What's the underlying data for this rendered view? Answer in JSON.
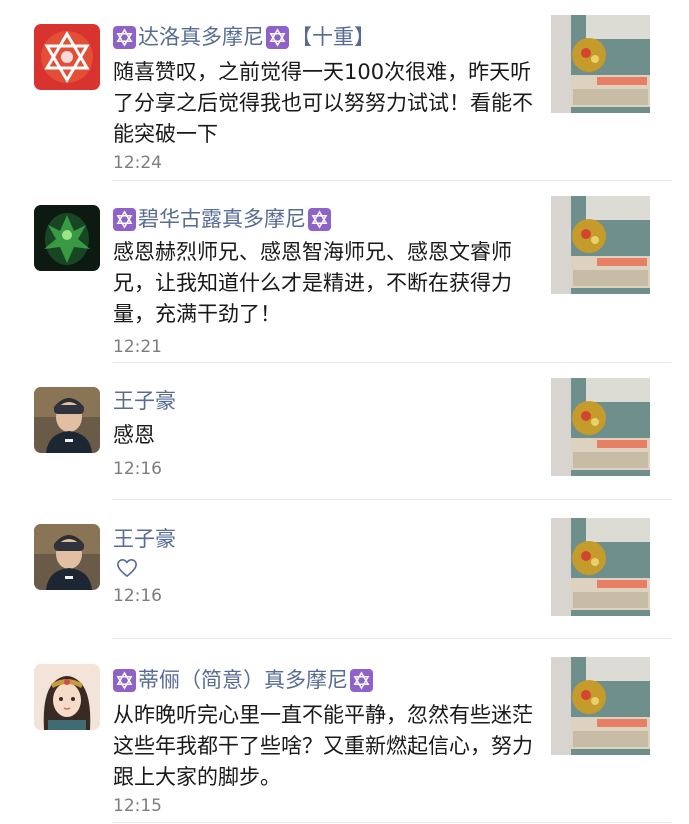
{
  "comments": [
    {
      "name_main": "达洛真多摩尼",
      "name_suffix": "【十重】",
      "text": "随喜赞叹，之前觉得一天100次很难，昨天听了分享之后觉得我也可以努努力试试！看能不能突破一下",
      "time": "12:24",
      "avatar": "red-star-avatar",
      "has_heart": false
    },
    {
      "name_main": "碧华古露真多摩尼",
      "name_suffix": "",
      "text": "感恩赫烈师兄、感恩智海师兄、感恩文睿师兄，让我知道什么才是精进，不断在获得力量，充满干劲了！",
      "time": "12:21",
      "avatar": "green-deity-avatar",
      "has_heart": false
    },
    {
      "name": "王子豪",
      "text": "感恩",
      "time": "12:16",
      "avatar": "child-photo-avatar",
      "has_heart": false
    },
    {
      "name": "王子豪",
      "text": "",
      "time": "12:16",
      "avatar": "child-photo-avatar",
      "has_heart": true,
      "icon": "heart-outline-icon"
    },
    {
      "name_main": "蒂俪（简意）真多摩尼",
      "name_suffix": "",
      "text": "从昨晚听完心里一直不能平静，忽然有些迷茫这些年我都干了些啥？又重新燃起信心，努力跟上大家的脚步。",
      "time": "12:15",
      "avatar": "illustrated-girl-avatar",
      "has_heart": false
    }
  ],
  "colors": {
    "name": "#576b95",
    "text": "#191919",
    "time": "#7d7d7d",
    "badge": "#8e62c9",
    "divider": "#e6e6e6"
  }
}
